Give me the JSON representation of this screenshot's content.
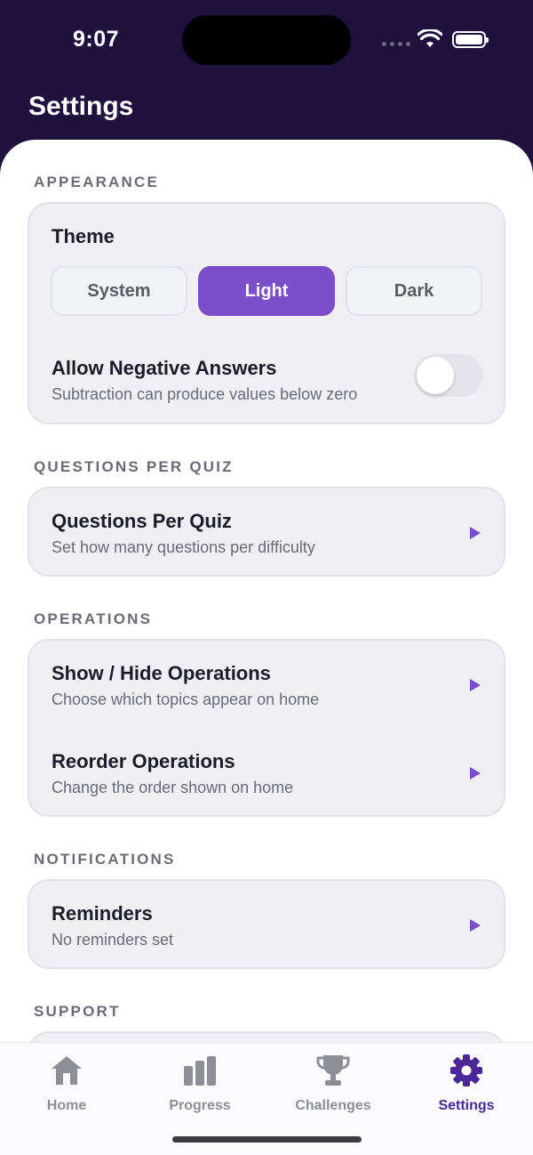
{
  "status_bar": {
    "time": "9:07"
  },
  "header": {
    "title": "Settings"
  },
  "sections": {
    "appearance": {
      "label": "APPEARANCE",
      "theme_title": "Theme",
      "theme_options": [
        "System",
        "Light",
        "Dark"
      ],
      "theme_selected": "Light",
      "negative_title": "Allow Negative Answers",
      "negative_sub": "Subtraction can produce values below zero",
      "negative_enabled": false
    },
    "questions": {
      "label": "QUESTIONS PER QUIZ",
      "title": "Questions Per Quiz",
      "sub": "Set how many questions per difficulty"
    },
    "operations": {
      "label": "OPERATIONS",
      "show_title": "Show / Hide Operations",
      "show_sub": "Choose which topics appear on home",
      "reorder_title": "Reorder Operations",
      "reorder_sub": "Change the order shown on home"
    },
    "notifications": {
      "label": "NOTIFICATIONS",
      "title": "Reminders",
      "sub": "No reminders set"
    },
    "support": {
      "label": "SUPPORT"
    }
  },
  "tabbar": {
    "items": [
      {
        "label": "Home",
        "icon": "home-icon"
      },
      {
        "label": "Progress",
        "icon": "bar-chart-icon"
      },
      {
        "label": "Challenges",
        "icon": "trophy-icon"
      },
      {
        "label": "Settings",
        "icon": "gear-icon"
      }
    ],
    "active": "Settings"
  },
  "colors": {
    "header_bg": "#20103d",
    "accent": "#7b4fc9",
    "active_tab": "#4a2799",
    "card_bg": "#efeff4"
  }
}
